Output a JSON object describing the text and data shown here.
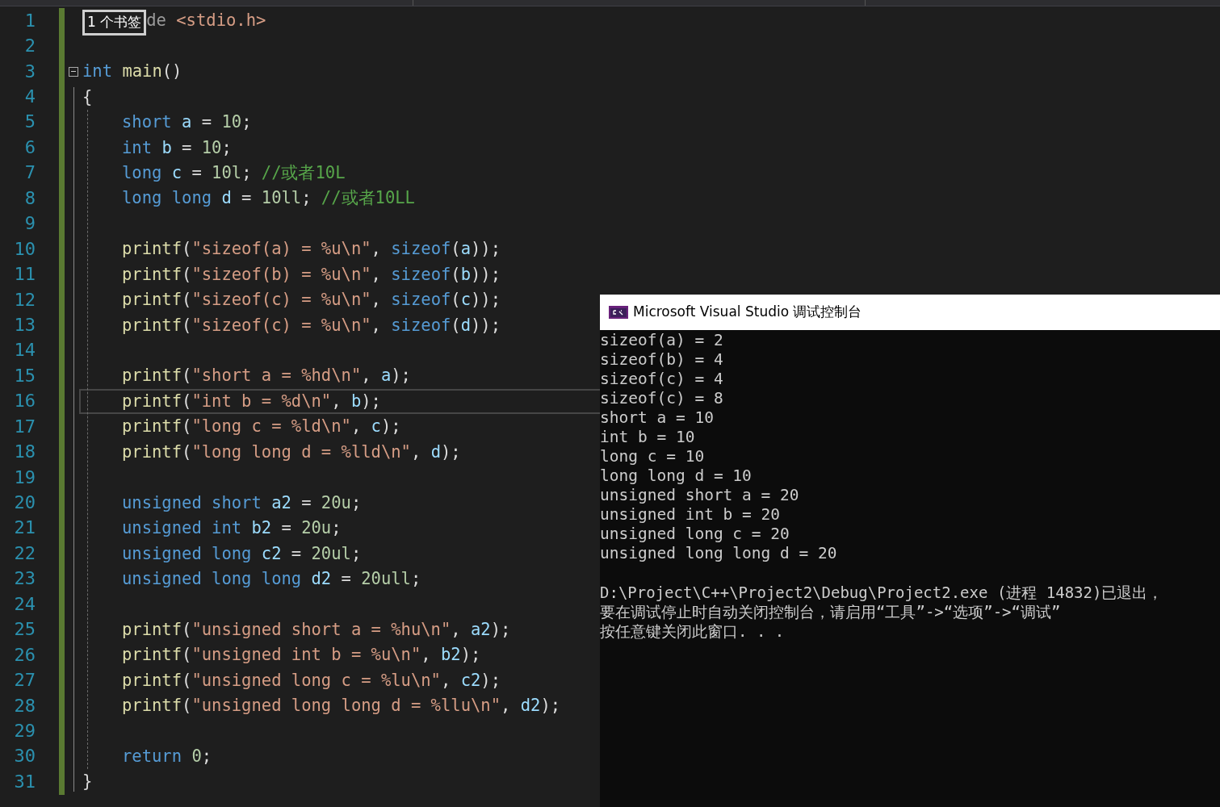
{
  "editor": {
    "lines": [
      {
        "n": "1",
        "indented": false,
        "current": false,
        "tooltip": "1 个书签",
        "tokens": [
          {
            "kind": "pre",
            "text": "de "
          },
          {
            "kind": "string",
            "text": "<stdio.h>"
          }
        ]
      },
      {
        "n": "2",
        "current": false
      },
      {
        "n": "3",
        "indented": false,
        "current": false,
        "fold": {
          "expanded": true
        },
        "tokens": [
          {
            "kind": "keyword",
            "text": "int "
          },
          {
            "kind": "function",
            "text": "main"
          },
          {
            "kind": "plain",
            "text": "()"
          }
        ]
      },
      {
        "n": "4",
        "indented": false,
        "current": false,
        "tokens": [
          {
            "kind": "plain",
            "text": "{"
          }
        ]
      },
      {
        "n": "5",
        "indented": true,
        "current": false,
        "tokens": [
          {
            "kind": "keyword",
            "text": "short "
          },
          {
            "kind": "variable",
            "text": "a"
          },
          {
            "kind": "plain",
            "text": " = "
          },
          {
            "kind": "number",
            "text": "10"
          },
          {
            "kind": "plain",
            "text": ";"
          }
        ]
      },
      {
        "n": "6",
        "indented": true,
        "current": false,
        "tokens": [
          {
            "kind": "keyword",
            "text": "int "
          },
          {
            "kind": "variable",
            "text": "b"
          },
          {
            "kind": "plain",
            "text": " = "
          },
          {
            "kind": "number",
            "text": "10"
          },
          {
            "kind": "plain",
            "text": ";"
          }
        ]
      },
      {
        "n": "7",
        "indented": true,
        "current": false,
        "tokens": [
          {
            "kind": "keyword",
            "text": "long "
          },
          {
            "kind": "variable",
            "text": "c"
          },
          {
            "kind": "plain",
            "text": " = "
          },
          {
            "kind": "number",
            "text": "10l"
          },
          {
            "kind": "plain",
            "text": "; "
          },
          {
            "kind": "comment",
            "text": "//或者10L"
          }
        ]
      },
      {
        "n": "8",
        "indented": true,
        "current": false,
        "tokens": [
          {
            "kind": "keyword",
            "text": "long long "
          },
          {
            "kind": "variable",
            "text": "d"
          },
          {
            "kind": "plain",
            "text": " = "
          },
          {
            "kind": "number",
            "text": "10ll"
          },
          {
            "kind": "plain",
            "text": "; "
          },
          {
            "kind": "comment",
            "text": "//或者10LL"
          }
        ]
      },
      {
        "n": "9",
        "current": false
      },
      {
        "n": "10",
        "indented": true,
        "current": false,
        "tokens": [
          {
            "kind": "function",
            "text": "printf"
          },
          {
            "kind": "plain",
            "text": "("
          },
          {
            "kind": "string",
            "text": "\"sizeof(a) = %u\\n\""
          },
          {
            "kind": "plain",
            "text": ", "
          },
          {
            "kind": "keyword",
            "text": "sizeof"
          },
          {
            "kind": "plain",
            "text": "("
          },
          {
            "kind": "variable",
            "text": "a"
          },
          {
            "kind": "plain",
            "text": "));"
          }
        ]
      },
      {
        "n": "11",
        "indented": true,
        "current": false,
        "tokens": [
          {
            "kind": "function",
            "text": "printf"
          },
          {
            "kind": "plain",
            "text": "("
          },
          {
            "kind": "string",
            "text": "\"sizeof(b) = %u\\n\""
          },
          {
            "kind": "plain",
            "text": ", "
          },
          {
            "kind": "keyword",
            "text": "sizeof"
          },
          {
            "kind": "plain",
            "text": "("
          },
          {
            "kind": "variable",
            "text": "b"
          },
          {
            "kind": "plain",
            "text": "));"
          }
        ]
      },
      {
        "n": "12",
        "indented": true,
        "current": false,
        "tokens": [
          {
            "kind": "function",
            "text": "printf"
          },
          {
            "kind": "plain",
            "text": "("
          },
          {
            "kind": "string",
            "text": "\"sizeof(c) = %u\\n\""
          },
          {
            "kind": "plain",
            "text": ", "
          },
          {
            "kind": "keyword",
            "text": "sizeof"
          },
          {
            "kind": "plain",
            "text": "("
          },
          {
            "kind": "variable",
            "text": "c"
          },
          {
            "kind": "plain",
            "text": "));"
          }
        ]
      },
      {
        "n": "13",
        "indented": true,
        "current": false,
        "tokens": [
          {
            "kind": "function",
            "text": "printf"
          },
          {
            "kind": "plain",
            "text": "("
          },
          {
            "kind": "string",
            "text": "\"sizeof(c) = %u\\n\""
          },
          {
            "kind": "plain",
            "text": ", "
          },
          {
            "kind": "keyword",
            "text": "sizeof"
          },
          {
            "kind": "plain",
            "text": "("
          },
          {
            "kind": "variable",
            "text": "d"
          },
          {
            "kind": "plain",
            "text": "));"
          }
        ]
      },
      {
        "n": "14",
        "current": false
      },
      {
        "n": "15",
        "indented": true,
        "current": false,
        "tokens": [
          {
            "kind": "function",
            "text": "printf"
          },
          {
            "kind": "plain",
            "text": "("
          },
          {
            "kind": "string",
            "text": "\"short a = %hd\\n\""
          },
          {
            "kind": "plain",
            "text": ", "
          },
          {
            "kind": "variable",
            "text": "a"
          },
          {
            "kind": "plain",
            "text": ");"
          }
        ]
      },
      {
        "n": "16",
        "indented": true,
        "current": true,
        "tokens": [
          {
            "kind": "function",
            "text": "printf"
          },
          {
            "kind": "plain",
            "text": "("
          },
          {
            "kind": "string",
            "text": "\"int b = %d\\n\""
          },
          {
            "kind": "plain",
            "text": ", "
          },
          {
            "kind": "variable",
            "text": "b"
          },
          {
            "kind": "plain",
            "text": ");"
          }
        ]
      },
      {
        "n": "17",
        "indented": true,
        "current": false,
        "tokens": [
          {
            "kind": "function",
            "text": "printf"
          },
          {
            "kind": "plain",
            "text": "("
          },
          {
            "kind": "string",
            "text": "\"long c = %ld\\n\""
          },
          {
            "kind": "plain",
            "text": ", "
          },
          {
            "kind": "variable",
            "text": "c"
          },
          {
            "kind": "plain",
            "text": ");"
          }
        ]
      },
      {
        "n": "18",
        "indented": true,
        "current": false,
        "tokens": [
          {
            "kind": "function",
            "text": "printf"
          },
          {
            "kind": "plain",
            "text": "("
          },
          {
            "kind": "string",
            "text": "\"long long d = %lld\\n\""
          },
          {
            "kind": "plain",
            "text": ", "
          },
          {
            "kind": "variable",
            "text": "d"
          },
          {
            "kind": "plain",
            "text": ");"
          }
        ]
      },
      {
        "n": "19",
        "current": false
      },
      {
        "n": "20",
        "indented": true,
        "current": false,
        "tokens": [
          {
            "kind": "keyword",
            "text": "unsigned short "
          },
          {
            "kind": "variable",
            "text": "a2"
          },
          {
            "kind": "plain",
            "text": " = "
          },
          {
            "kind": "number",
            "text": "20u"
          },
          {
            "kind": "plain",
            "text": ";"
          }
        ]
      },
      {
        "n": "21",
        "indented": true,
        "current": false,
        "tokens": [
          {
            "kind": "keyword",
            "text": "unsigned int "
          },
          {
            "kind": "variable",
            "text": "b2"
          },
          {
            "kind": "plain",
            "text": " = "
          },
          {
            "kind": "number",
            "text": "20u"
          },
          {
            "kind": "plain",
            "text": ";"
          }
        ]
      },
      {
        "n": "22",
        "indented": true,
        "current": false,
        "tokens": [
          {
            "kind": "keyword",
            "text": "unsigned long "
          },
          {
            "kind": "variable",
            "text": "c2"
          },
          {
            "kind": "plain",
            "text": " = "
          },
          {
            "kind": "number",
            "text": "20ul"
          },
          {
            "kind": "plain",
            "text": ";"
          }
        ]
      },
      {
        "n": "23",
        "indented": true,
        "current": false,
        "tokens": [
          {
            "kind": "keyword",
            "text": "unsigned long long "
          },
          {
            "kind": "variable",
            "text": "d2"
          },
          {
            "kind": "plain",
            "text": " = "
          },
          {
            "kind": "number",
            "text": "20ull"
          },
          {
            "kind": "plain",
            "text": ";"
          }
        ]
      },
      {
        "n": "24",
        "current": false
      },
      {
        "n": "25",
        "indented": true,
        "current": false,
        "tokens": [
          {
            "kind": "function",
            "text": "printf"
          },
          {
            "kind": "plain",
            "text": "("
          },
          {
            "kind": "string",
            "text": "\"unsigned short a = %hu\\n\""
          },
          {
            "kind": "plain",
            "text": ", "
          },
          {
            "kind": "variable",
            "text": "a2"
          },
          {
            "kind": "plain",
            "text": ");"
          }
        ]
      },
      {
        "n": "26",
        "indented": true,
        "current": false,
        "tokens": [
          {
            "kind": "function",
            "text": "printf"
          },
          {
            "kind": "plain",
            "text": "("
          },
          {
            "kind": "string",
            "text": "\"unsigned int b = %u\\n\""
          },
          {
            "kind": "plain",
            "text": ", "
          },
          {
            "kind": "variable",
            "text": "b2"
          },
          {
            "kind": "plain",
            "text": ");"
          }
        ]
      },
      {
        "n": "27",
        "indented": true,
        "current": false,
        "tokens": [
          {
            "kind": "function",
            "text": "printf"
          },
          {
            "kind": "plain",
            "text": "("
          },
          {
            "kind": "string",
            "text": "\"unsigned long c = %lu\\n\""
          },
          {
            "kind": "plain",
            "text": ", "
          },
          {
            "kind": "variable",
            "text": "c2"
          },
          {
            "kind": "plain",
            "text": ");"
          }
        ]
      },
      {
        "n": "28",
        "indented": true,
        "current": false,
        "tokens": [
          {
            "kind": "function",
            "text": "printf"
          },
          {
            "kind": "plain",
            "text": "("
          },
          {
            "kind": "string",
            "text": "\"unsigned long long d = %llu\\n\""
          },
          {
            "kind": "plain",
            "text": ", "
          },
          {
            "kind": "variable",
            "text": "d2"
          },
          {
            "kind": "plain",
            "text": ");"
          }
        ]
      },
      {
        "n": "29",
        "current": false
      },
      {
        "n": "30",
        "indented": true,
        "current": false,
        "tokens": [
          {
            "kind": "keyword",
            "text": "return "
          },
          {
            "kind": "number",
            "text": "0"
          },
          {
            "kind": "plain",
            "text": ";"
          }
        ]
      },
      {
        "n": "31",
        "indented": false,
        "current": false,
        "tokens": [
          {
            "kind": "plain",
            "text": "}"
          }
        ]
      }
    ]
  },
  "console": {
    "title": "Microsoft Visual Studio 调试控制台",
    "output": [
      "sizeof(a) = 2",
      "sizeof(b) = 4",
      "sizeof(c) = 4",
      "sizeof(c) = 8",
      "short a = 10",
      "int b = 10",
      "long c = 10",
      "long long d = 10",
      "unsigned short a = 20",
      "unsigned int b = 20",
      "unsigned long c = 20",
      "unsigned long long d = 20"
    ],
    "messages": [
      "D:\\Project\\C++\\Project2\\Debug\\Project2.exe (进程 14832)已退出，",
      "要在调试停止时自动关闭控制台，请启用“工具”->“选项”->“调试”",
      "按任意键关闭此窗口. . ."
    ]
  }
}
